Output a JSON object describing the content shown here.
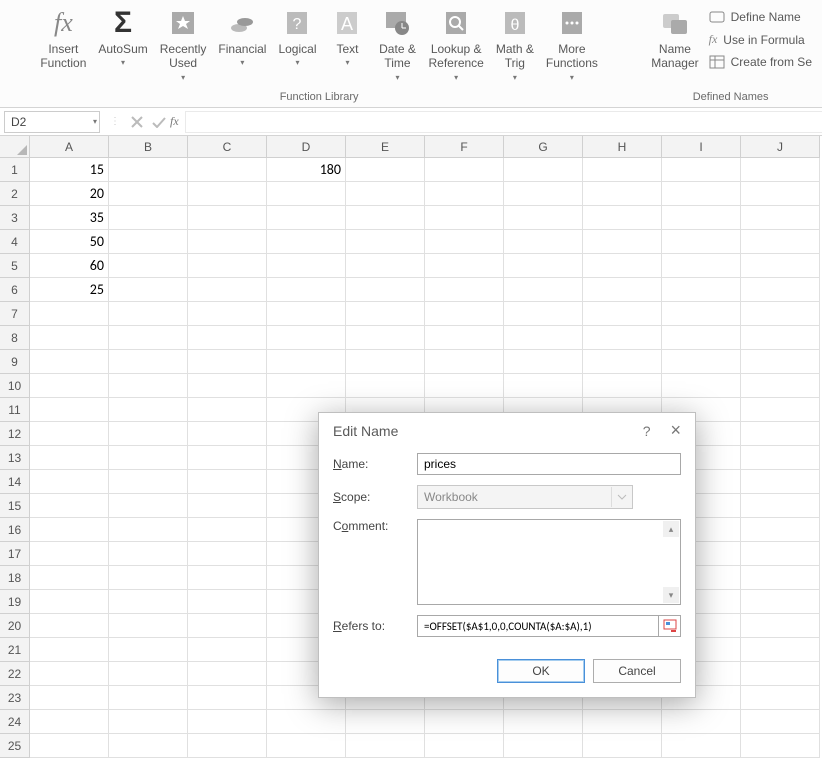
{
  "ribbon": {
    "insert_function": "Insert\nFunction",
    "autosum": "AutoSum",
    "recently_used": "Recently\nUsed",
    "financial": "Financial",
    "logical": "Logical",
    "text": "Text",
    "date_time": "Date &\nTime",
    "lookup_ref": "Lookup &\nReference",
    "math_trig": "Math &\nTrig",
    "more_functions": "More\nFunctions",
    "name_manager": "Name\nManager",
    "define_name": "Define Name",
    "use_in_formula": "Use in Formula",
    "create_from_selection": "Create from Se",
    "group_function_library": "Function Library",
    "group_defined_names": "Defined Names"
  },
  "formula_bar": {
    "name_box": "D2",
    "formula": ""
  },
  "grid": {
    "columns": [
      "A",
      "B",
      "C",
      "D",
      "E",
      "F",
      "G",
      "H",
      "I",
      "J"
    ],
    "row_count": 25,
    "cells": {
      "A1": "15",
      "A2": "20",
      "A3": "35",
      "A4": "50",
      "A5": "60",
      "A6": "25",
      "D1": "180"
    }
  },
  "dialog": {
    "title": "Edit Name",
    "labels": {
      "name": "Name:",
      "scope": "Scope:",
      "comment": "Comment:",
      "refers_to": "Refers to:"
    },
    "underline": {
      "name": "N",
      "scope": "S",
      "comment": "o",
      "refers": "R"
    },
    "name_value": "prices",
    "scope_value": "Workbook",
    "comment_value": "",
    "refers_to_value": "=OFFSET($A$1,0,0,COUNTA($A:$A),1)",
    "ok": "OK",
    "cancel": "Cancel",
    "help": "?",
    "close": "×"
  }
}
